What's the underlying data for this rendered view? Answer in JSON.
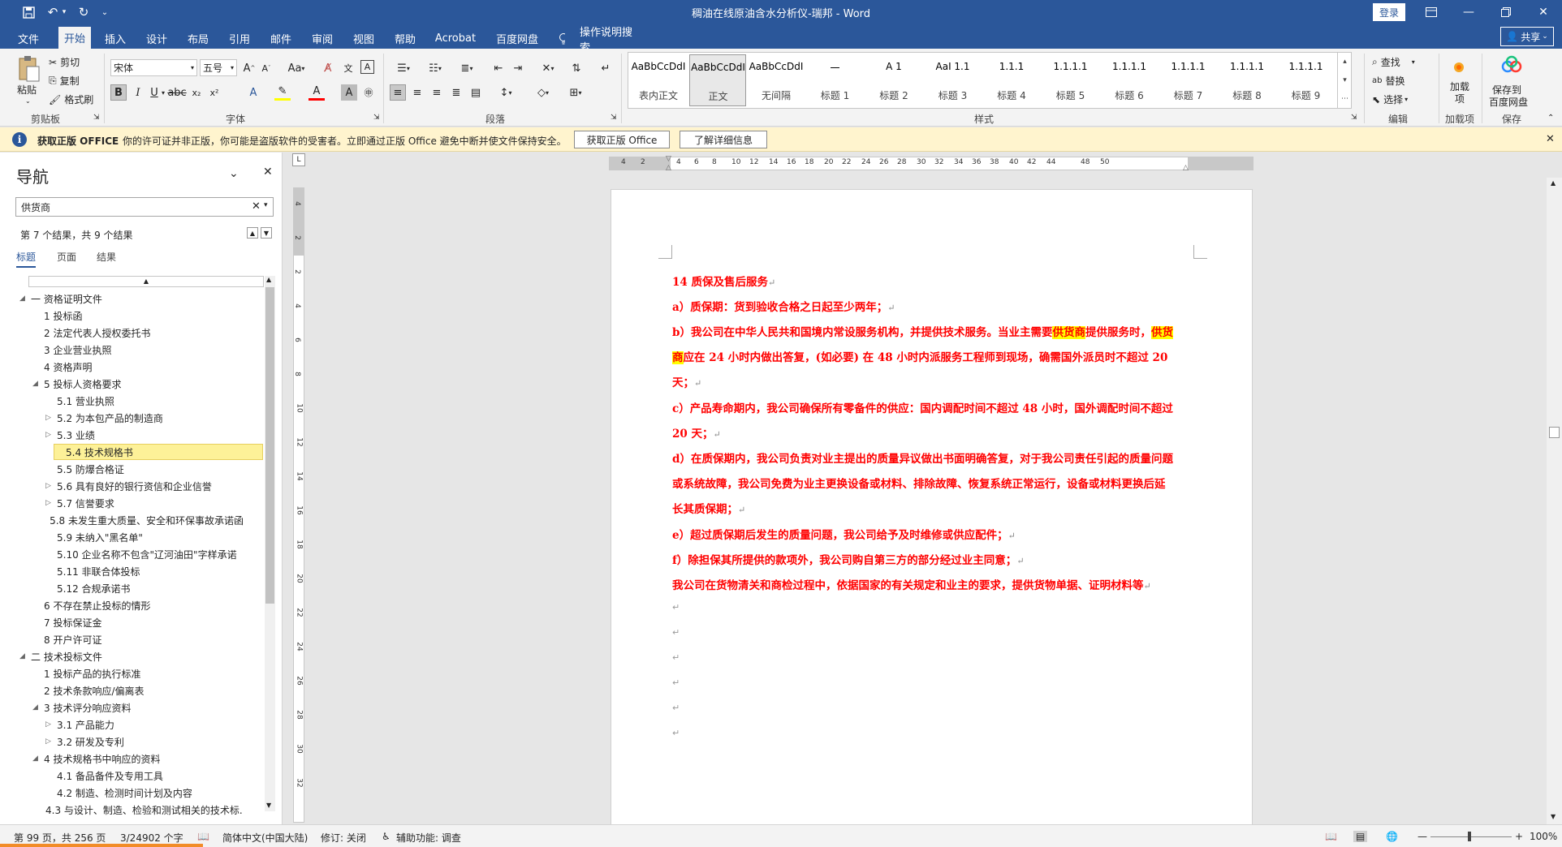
{
  "window": {
    "title": "稠油在线原油含水分析仪-瑞邦 - Word",
    "login": "登录",
    "share": "共享"
  },
  "tabs": [
    "文件",
    "开始",
    "插入",
    "设计",
    "布局",
    "引用",
    "邮件",
    "审阅",
    "视图",
    "帮助",
    "Acrobat",
    "百度网盘"
  ],
  "tell_me": "操作说明搜索",
  "ribbon": {
    "clipboard": {
      "paste": "粘贴",
      "cut": "剪切",
      "copy": "复制",
      "format_painter": "格式刷",
      "label": "剪贴板"
    },
    "font": {
      "name": "宋体",
      "size": "五号",
      "label": "字体"
    },
    "paragraph": {
      "label": "段落"
    },
    "styles": {
      "label": "样式",
      "items": [
        {
          "preview": "AaBbCcDdI",
          "name": "表内正文"
        },
        {
          "preview": "AaBbCcDdI",
          "name": "正文"
        },
        {
          "preview": "AaBbCcDdI",
          "name": "无间隔"
        },
        {
          "preview": "一",
          "name": "标题 1"
        },
        {
          "preview": "A 1",
          "name": "标题 2"
        },
        {
          "preview": "AaI 1.1",
          "name": "标题 3"
        },
        {
          "preview": "1.1.1",
          "name": "标题 4"
        },
        {
          "preview": "1.1.1.1",
          "name": "标题 5"
        },
        {
          "preview": "1.1.1.1",
          "name": "标题 6"
        },
        {
          "preview": "1.1.1.1",
          "name": "标题 7"
        },
        {
          "preview": "1.1.1.1",
          "name": "标题 8"
        },
        {
          "preview": "1.1.1.1",
          "name": "标题 9"
        }
      ]
    },
    "editing": {
      "find": "查找",
      "replace": "替换",
      "select": "选择",
      "label": "编辑"
    },
    "addins": {
      "btn": "加载项",
      "label": "加载项"
    },
    "save": {
      "btn1": "保存到",
      "btn2": "百度网盘",
      "label": "保存"
    }
  },
  "message_bar": {
    "title": "获取正版 OFFICE",
    "text": "你的许可证并非正版，你可能是盗版软件的受害者。立即通过正版 Office 避免中断并使文件保持安全。",
    "btn_get": "获取正版 Office",
    "btn_more": "了解详细信息"
  },
  "nav": {
    "title": "导航",
    "search_value": "供货商",
    "result_text": "第 7 个结果，共 9 个结果",
    "tabs": [
      "标题",
      "页面",
      "结果"
    ],
    "tree": [
      {
        "text": "一 资格证明文件",
        "level": 0,
        "tw": "◢"
      },
      {
        "text": "1 投标函",
        "level": 1,
        "tw": ""
      },
      {
        "text": "2 法定代表人授权委托书",
        "level": 1,
        "tw": ""
      },
      {
        "text": "3 企业营业执照",
        "level": 1,
        "tw": ""
      },
      {
        "text": "4 资格声明",
        "level": 1,
        "tw": ""
      },
      {
        "text": "5 投标人资格要求",
        "level": 1,
        "tw": "◢"
      },
      {
        "text": "5.1 营业执照",
        "level": 2,
        "tw": ""
      },
      {
        "text": "5.2 为本包产品的制造商",
        "level": 2,
        "tw": "▷"
      },
      {
        "text": "5.3 业绩",
        "level": 2,
        "tw": "▷"
      },
      {
        "text": "5.4 技术规格书",
        "level": 2,
        "tw": "",
        "hl": true
      },
      {
        "text": "5.5 防爆合格证",
        "level": 2,
        "tw": ""
      },
      {
        "text": "5.6 具有良好的银行资信和企业信誉",
        "level": 2,
        "tw": "▷"
      },
      {
        "text": "5.7 信誉要求",
        "level": 2,
        "tw": "▷"
      },
      {
        "text": "5.8 未发生重大质量、安全和环保事故承诺函",
        "level": 2,
        "tw": ""
      },
      {
        "text": "5.9 未纳入\"黑名单\"",
        "level": 2,
        "tw": ""
      },
      {
        "text": "5.10 企业名称不包含\"辽河油田\"字样承诺",
        "level": 2,
        "tw": ""
      },
      {
        "text": "5.11 非联合体投标",
        "level": 2,
        "tw": ""
      },
      {
        "text": "5.12 合规承诺书",
        "level": 2,
        "tw": ""
      },
      {
        "text": "6 不存在禁止投标的情形",
        "level": 1,
        "tw": ""
      },
      {
        "text": "7 投标保证金",
        "level": 1,
        "tw": ""
      },
      {
        "text": "8 开户许可证",
        "level": 1,
        "tw": ""
      },
      {
        "text": "二 技术投标文件",
        "level": 0,
        "tw": "◢"
      },
      {
        "text": "1 投标产品的执行标准",
        "level": 1,
        "tw": ""
      },
      {
        "text": "2 技术条款响应/偏离表",
        "level": 1,
        "tw": ""
      },
      {
        "text": "3 技术评分响应资料",
        "level": 1,
        "tw": "◢"
      },
      {
        "text": "3.1 产品能力",
        "level": 2,
        "tw": "▷"
      },
      {
        "text": "3.2 研发及专利",
        "level": 2,
        "tw": "▷"
      },
      {
        "text": "4 技术规格书中响应的资料",
        "level": 1,
        "tw": "◢"
      },
      {
        "text": "4.1 备品备件及专用工具",
        "level": 2,
        "tw": ""
      },
      {
        "text": "4.2 制造、检测时间计划及内容",
        "level": 2,
        "tw": ""
      },
      {
        "text": "4.3 与设计、制造、检验和测试相关的技术标...",
        "level": 2,
        "tw": ""
      }
    ]
  },
  "ruler_numbers": [
    "4",
    "2",
    "2",
    "4",
    "6",
    "8",
    "10",
    "12",
    "14",
    "16",
    "18",
    "20",
    "22",
    "24",
    "26",
    "28",
    "30",
    "32",
    "34",
    "36",
    "38",
    "40",
    "42",
    "44",
    "48",
    "50"
  ],
  "vruler_numbers": [
    "4",
    "2",
    "2",
    "4",
    "6",
    "8",
    "10",
    "12",
    "14",
    "16",
    "18",
    "20",
    "22",
    "24",
    "26",
    "28",
    "30",
    "32"
  ],
  "document": {
    "paragraphs": [
      {
        "runs": [
          {
            "t": "14 质保及售后服务"
          }
        ]
      },
      {
        "runs": [
          {
            "t": "a）质保期：货到验收合格之日起至少两年；"
          }
        ]
      },
      {
        "runs": [
          {
            "t": "b）我公司在中华人民共和国境内常设服务机构，并提供技术服务。当业主需要"
          },
          {
            "t": "供货商",
            "h": true
          },
          {
            "t": "提供服务时，"
          },
          {
            "t": "供货",
            "h": true
          }
        ]
      },
      {
        "runs": [
          {
            "t": "商",
            "h": true
          },
          {
            "t": "应在 24 小时内做出答复，(如必要) 在 48 小时内派服务工程师到现场，确需国外派员时不超过 20"
          }
        ]
      },
      {
        "runs": [
          {
            "t": "天；"
          }
        ]
      },
      {
        "runs": [
          {
            "t": "c）产品寿命期内，我公司确保所有零备件的供应：国内调配时间不超过 48 小时，国外调配时间不超过"
          }
        ]
      },
      {
        "runs": [
          {
            "t": "20 天；"
          }
        ]
      },
      {
        "runs": [
          {
            "t": "d）在质保期内，我公司负责对业主提出的质量异议做出书面明确答复，对于我公司责任引起的质量问题"
          }
        ]
      },
      {
        "runs": [
          {
            "t": "或系统故障，我公司免费为业主更换设备或材料、排除故障、恢复系统正常运行，设备或材料更换后延"
          }
        ]
      },
      {
        "runs": [
          {
            "t": "长其质保期；"
          }
        ]
      },
      {
        "runs": [
          {
            "t": "e）超过质保期后发生的质量问题，我公司给予及时维修或供应配件；"
          }
        ]
      },
      {
        "runs": [
          {
            "t": "f）除担保其所提供的款项外，我公司购自第三方的部分经过业主同意；"
          }
        ]
      },
      {
        "runs": [
          {
            "t": "我公司在货物清关和商检过程中，依据国家的有关规定和业主的要求，提供货物单据、证明材料等"
          }
        ]
      }
    ],
    "empty_marks": 6,
    "para_mark": "↵"
  },
  "status": {
    "page": "第 99 页，共 256 页",
    "words": "3/24902 个字",
    "language": "简体中文(中国大陆)",
    "track": "修订: 关闭",
    "accessibility": "辅助功能: 调查",
    "zoom": "100%"
  }
}
